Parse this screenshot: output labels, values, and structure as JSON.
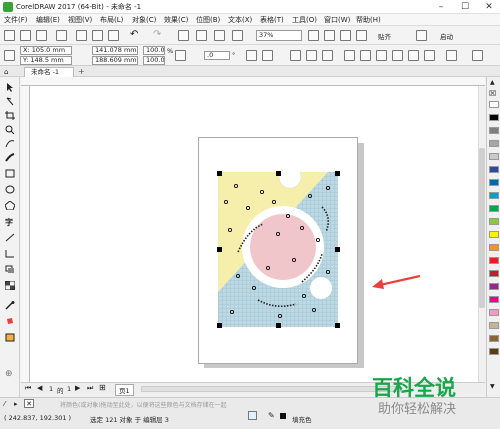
{
  "window": {
    "title": "CorelDRAW 2017 (64-Bit) - 未命名 -1"
  },
  "menu": [
    "文件(F)",
    "编辑(E)",
    "视图(V)",
    "布局(L)",
    "对象(C)",
    "效果(C)",
    "位图(B)",
    "文本(X)",
    "表格(T)",
    "工具(O)",
    "窗口(W)",
    "帮助(H)"
  ],
  "toolbar": {
    "zoom": "37%",
    "snap_label": "贴齐",
    "launch_label": "启动"
  },
  "propbar": {
    "x": "X: 105.0 mm",
    "y": "Y: 148.5 mm",
    "width": "141.078 mm",
    "height": "188.609 mm",
    "scale_x": "100.0",
    "scale_y": "100.0",
    "percent": "%",
    "rotation": ".0",
    "unit_symbol": "°"
  },
  "document_tab": "未命名 -1",
  "page_nav": {
    "current": "1",
    "of": "的",
    "total": "1",
    "page_tab": "页1"
  },
  "status": {
    "coords": "( 242.837, 192.301 )",
    "selection": "选定 121 对象 于 编辑层 3",
    "fill_label": "填充色"
  },
  "watermark": {
    "line1": "百科全说",
    "line2": "助你轻松解决",
    "hint": "将颜色(或对象)拖动至此处，以便将这些颜色与文档存储在一起"
  },
  "colors": {
    "yellow_panel": "#f6eeab",
    "blue_panel": "#bcd8e2",
    "pink_circle": "#f1c6cb",
    "arrow": "#e8413c",
    "palette": [
      "#ffffff",
      "#000000",
      "#7f7f7f",
      "#a6a6a6",
      "#c9c9c9",
      "#2e4a9e",
      "#0067b2",
      "#009fe3",
      "#00a650",
      "#8dc63f",
      "#fff200",
      "#f7941d",
      "#ed1c24",
      "#be1e2d",
      "#92278f",
      "#ec008c",
      "#f49ac1",
      "#c7b299",
      "#8c6239",
      "#603913"
    ]
  }
}
